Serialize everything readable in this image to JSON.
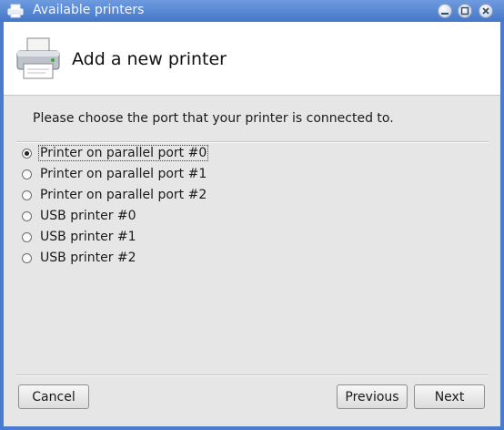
{
  "window": {
    "title": "Available printers",
    "app_icon": "printer-small-icon",
    "controls": [
      "minimize-icon",
      "maximize-icon",
      "close-icon"
    ]
  },
  "header": {
    "icon": "printer-icon",
    "title": "Add a new printer"
  },
  "prompt": "Please choose the port that your printer is connected to.",
  "ports": [
    {
      "label": "Printer on parallel port #0",
      "selected": true
    },
    {
      "label": "Printer on parallel port #1",
      "selected": false
    },
    {
      "label": "Printer on parallel port #2",
      "selected": false
    },
    {
      "label": "USB printer #0",
      "selected": false
    },
    {
      "label": "USB printer #1",
      "selected": false
    },
    {
      "label": "USB printer #2",
      "selected": false
    }
  ],
  "buttons": {
    "cancel": "Cancel",
    "previous": "Previous",
    "next": "Next"
  },
  "colors": {
    "titlebar": "#4a7ccd",
    "dialog_background": "#e6e6e6",
    "header_background": "#ffffff"
  }
}
